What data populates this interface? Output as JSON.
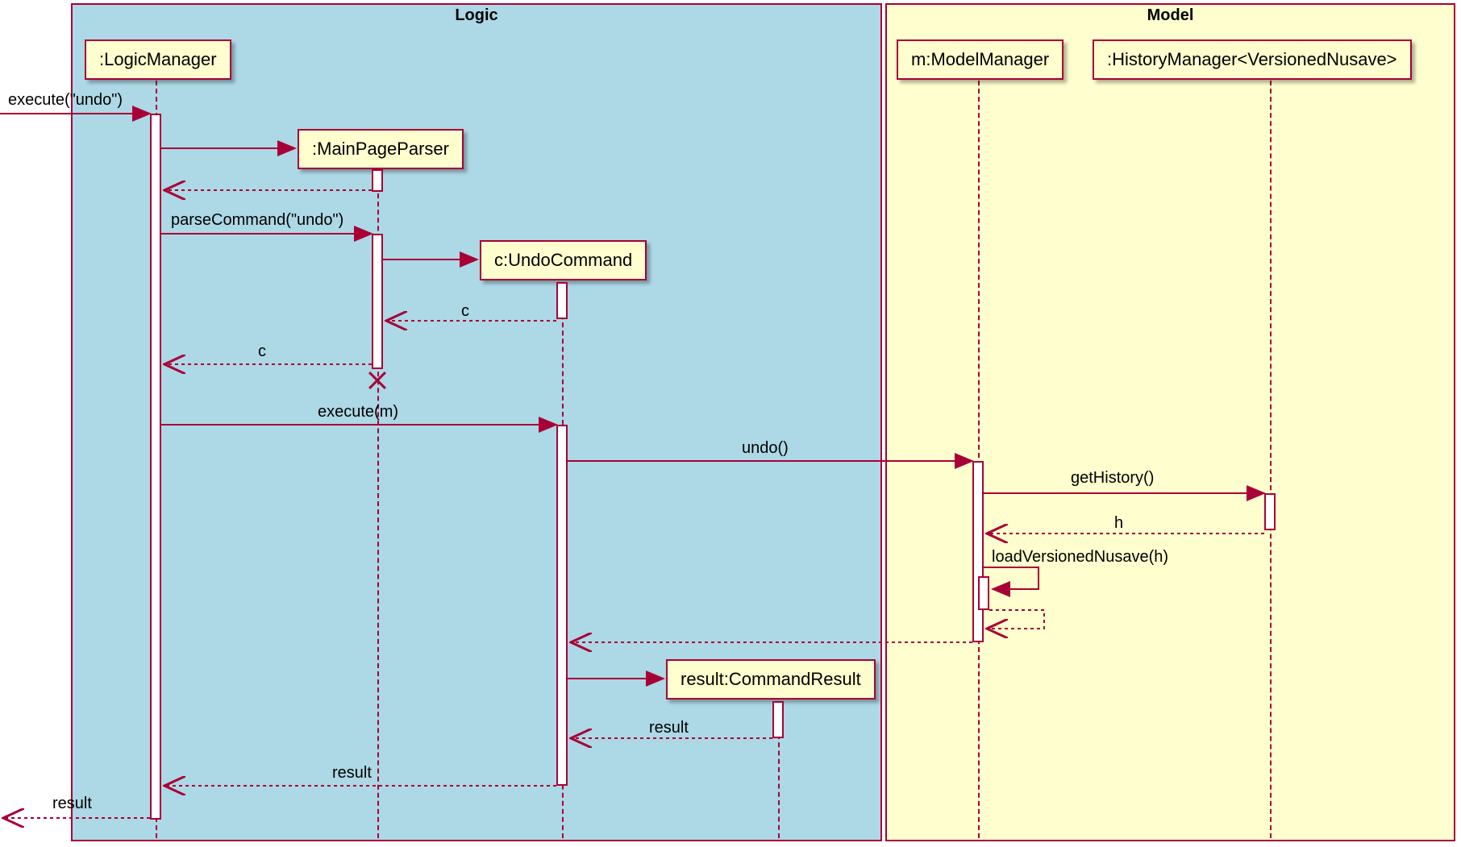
{
  "frames": {
    "logic": {
      "label": "Logic"
    },
    "model": {
      "label": "Model"
    }
  },
  "participants": {
    "logicManager": ":LogicManager",
    "mainPageParser": ":MainPageParser",
    "undoCommand": "c:UndoCommand",
    "commandResult": "result:CommandResult",
    "modelManager": "m:ModelManager",
    "historyManager": ":HistoryManager<VersionedNusave>"
  },
  "messages": {
    "executeUndo": "execute(\"undo\")",
    "parseCommand": "parseCommand(\"undo\")",
    "c": "c",
    "executeM": "execute(m)",
    "undo": "undo()",
    "getHistory": "getHistory()",
    "h": "h",
    "loadVersionedNusave": "loadVersionedNusave(h)",
    "result": "result"
  }
}
